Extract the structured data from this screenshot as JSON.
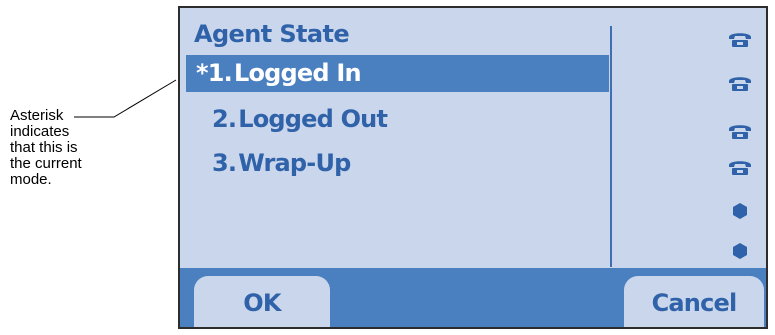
{
  "annotation": {
    "lines": [
      "Asterisk",
      "indicates",
      "that this is",
      "the current",
      "mode."
    ]
  },
  "screen": {
    "title": "Agent State",
    "items": [
      {
        "marker": "*",
        "number": "1.",
        "label": "Logged In",
        "selected": true
      },
      {
        "marker": "",
        "number": "2.",
        "label": "Logged Out",
        "selected": false
      },
      {
        "marker": "",
        "number": "3.",
        "label": "Wrap-Up",
        "selected": false
      }
    ],
    "line_icons": [
      "phone-icon",
      "phone-icon",
      "phone-icon",
      "phone-icon",
      "line-dot-icon",
      "line-dot-icon"
    ],
    "softkeys": {
      "left": "OK",
      "right": "Cancel"
    }
  },
  "colors": {
    "screen_bg": "#cad6ec",
    "accent": "#4a7fc0",
    "text": "#2f62a8",
    "selected_text": "#ffffff"
  }
}
